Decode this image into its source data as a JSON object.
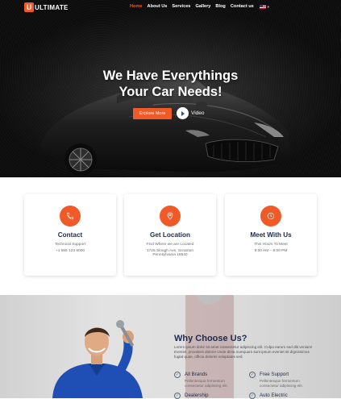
{
  "brand": {
    "logo_letter": "U",
    "name": "ULTIMATE"
  },
  "nav": {
    "items": [
      {
        "label": "Home",
        "active": true
      },
      {
        "label": "About Us"
      },
      {
        "label": "Services"
      },
      {
        "label": "Gallery"
      },
      {
        "label": "Blog"
      },
      {
        "label": "Contact us"
      }
    ]
  },
  "hero": {
    "title_line1": "We Have Everythings",
    "title_line2": "Your Car Needs!",
    "explore_label": "Explore More",
    "video_label": "Video"
  },
  "cards": [
    {
      "title": "Contact",
      "line1": "Technical Support",
      "line2": "+1 555 123 8000",
      "icon": "phone-icon"
    },
    {
      "title": "Get Location",
      "line1": "Find Where we are Located",
      "line2": "1725 Slough Ave, Scranton",
      "line3": "Pennsylvania 18540",
      "icon": "location-pin-icon"
    },
    {
      "title": "Meet With Us",
      "line1": "This Hours To  Meet",
      "line2": "9:00 AM – 8:00 PM",
      "icon": "clock-icon"
    }
  ],
  "why": {
    "title": "Why Choose Us?",
    "text": "Lorem ipsum dolor sit amet consectetur adipiscing elit. Culpa earum sed diti veniam! Eveniet, provident dolore! Unde dicta numquam sunt ipsum eveniet sit dignissimos fugiat quae, officia dolores voluptates sed.",
    "features": [
      {
        "title": "All Brands",
        "desc": "Pellentesque fermentum consectetur adipiscing elit."
      },
      {
        "title": "Free Support",
        "desc": "Pellentesque fermentum consectetur adipiscing elit."
      },
      {
        "title": "Dealership",
        "desc": ""
      },
      {
        "title": "Auto Electric",
        "desc": ""
      }
    ]
  },
  "colors": {
    "accent": "#f05a28",
    "navy": "#1d2a4d"
  }
}
